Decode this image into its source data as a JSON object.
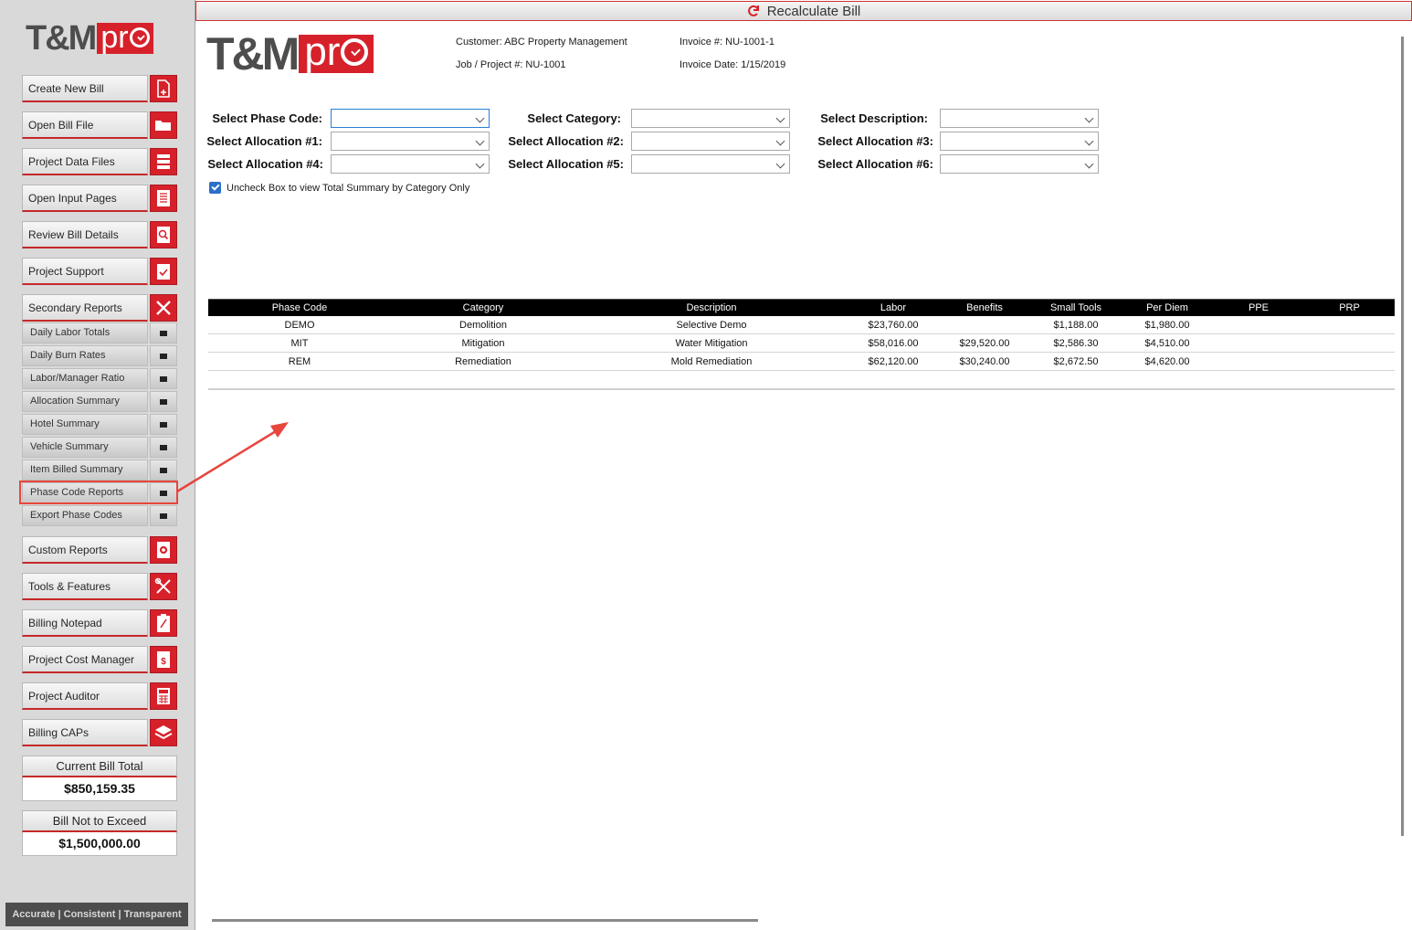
{
  "app": {
    "logo_text": "T&M",
    "logo_pro": "pr",
    "recalc_label": "Recalculate Bill"
  },
  "sidebar": {
    "buttons": [
      {
        "label": "Create New Bill",
        "icon": "new-file-icon"
      },
      {
        "label": "Open Bill File",
        "icon": "folder-icon"
      },
      {
        "label": "Project Data Files",
        "icon": "database-icon"
      },
      {
        "label": "Open Input Pages",
        "icon": "document-lines-icon"
      },
      {
        "label": "Review Bill Details",
        "icon": "magnifier-document-icon"
      },
      {
        "label": "Project Support",
        "icon": "checklist-icon"
      },
      {
        "label": "Secondary Reports",
        "icon": "close-x-icon"
      }
    ],
    "sub_items": [
      "Daily Labor Totals",
      "Daily Burn Rates",
      "Labor/Manager Ratio",
      "Allocation Summary",
      "Hotel Summary",
      "Vehicle Summary",
      "Item Billed Summary",
      "Phase Code Reports",
      "Export Phase Codes"
    ],
    "buttons2": [
      {
        "label": "Custom Reports",
        "icon": "gear-document-icon"
      },
      {
        "label": "Tools & Features",
        "icon": "tools-icon"
      },
      {
        "label": "Billing Notepad",
        "icon": "notepad-icon"
      },
      {
        "label": "Project Cost Manager",
        "icon": "dollar-document-icon"
      },
      {
        "label": "Project Auditor",
        "icon": "calculator-icon"
      },
      {
        "label": "Billing CAPs",
        "icon": "layers-icon"
      }
    ],
    "current_total_label": "Current Bill Total",
    "current_total_value": "$850,159.35",
    "nte_label": "Bill Not to Exceed",
    "nte_value": "$1,500,000.00",
    "tagline": "Accurate | Consistent | Transparent"
  },
  "header": {
    "customer": "Customer: ABC Property Management",
    "job": "Job / Project #: NU-1001",
    "invoice_no": "Invoice #: NU-1001-1",
    "invoice_date": "Invoice Date: 1/15/2019"
  },
  "filters": {
    "phase_code": "Select Phase Code:",
    "category": "Select Category:",
    "description": "Select Description:",
    "alloc1": "Select Allocation #1:",
    "alloc2": "Select Allocation #2:",
    "alloc3": "Select Allocation #3:",
    "alloc4": "Select Allocation #4:",
    "alloc5": "Select Allocation #5:",
    "alloc6": "Select Allocation #6:",
    "checkbox_label": "Uncheck Box to view Total Summary by Category Only",
    "checkbox_checked": true
  },
  "table": {
    "columns": [
      "Phase Code",
      "Category",
      "Description",
      "Labor",
      "Benefits",
      "Small Tools",
      "Per Diem",
      "PPE",
      "PRP"
    ],
    "rows": [
      [
        "DEMO",
        "Demolition",
        "Selective Demo",
        "$23,760.00",
        "",
        "$1,188.00",
        "$1,980.00",
        "",
        ""
      ],
      [
        "MIT",
        "Mitigation",
        "Water Mitigation",
        "$58,016.00",
        "$29,520.00",
        "$2,586.30",
        "$4,510.00",
        "",
        ""
      ],
      [
        "REM",
        "Remediation",
        "Mold Remediation",
        "$62,120.00",
        "$30,240.00",
        "$2,672.50",
        "$4,620.00",
        "",
        ""
      ]
    ]
  },
  "colors": {
    "brand_red": "#d6212b",
    "annotation_red": "#e8453c",
    "sidebar_bg": "#d9d9d9"
  }
}
